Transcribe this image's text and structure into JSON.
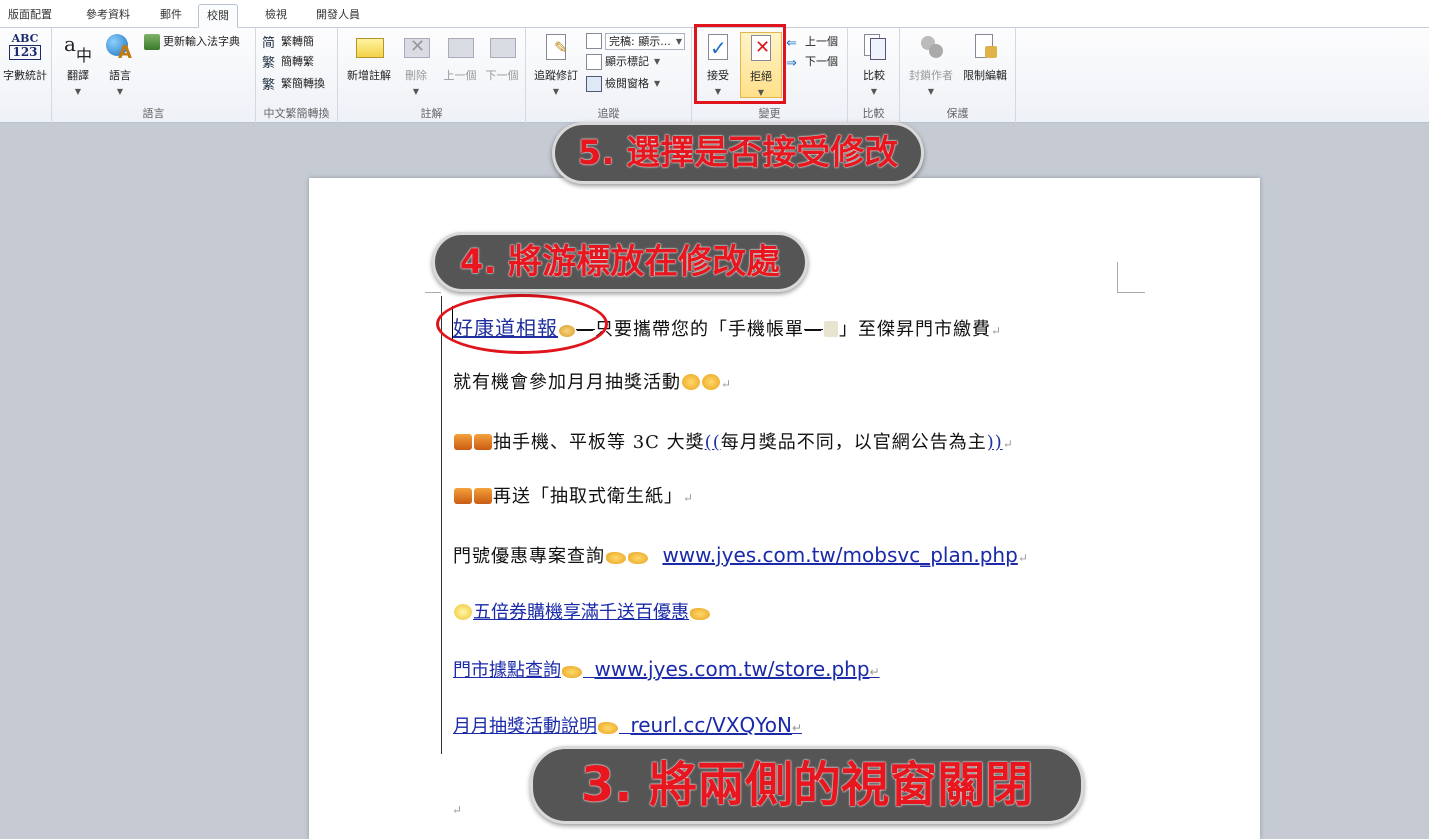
{
  "tabs": [
    "版面配置",
    "參考資料",
    "郵件",
    "校閱",
    "檢視",
    "開發人員"
  ],
  "active_tab": "校閱",
  "ribbon": {
    "proofing": {
      "word_count_icon_top": "ABC",
      "word_count_icon_bottom": "123",
      "word_count": "字數統計"
    },
    "language": {
      "translate": "翻譯",
      "language": "語言",
      "update_ime": "更新輸入法字典",
      "label": "語言"
    },
    "chinese": {
      "trad_to_simp": "繁轉簡",
      "simp_to_trad": "簡轉繁",
      "convert": "繁簡轉換",
      "label": "中文繁簡轉換"
    },
    "comments": {
      "new": "新增註解",
      "delete": "刪除",
      "prev": "上一個",
      "next": "下一個",
      "label": "註解"
    },
    "tracking": {
      "track_changes": "追蹤修訂",
      "display_combo": "完稿: 顯示...",
      "show_markup": "顯示標記",
      "review_pane": "檢閱窗格",
      "label": "追蹤"
    },
    "changes": {
      "accept": "接受",
      "reject": "拒絕",
      "prev": "上一個",
      "next": "下一個",
      "label": "變更"
    },
    "compare": {
      "compare": "比較",
      "label": "比較"
    },
    "protect": {
      "block_authors": "封鎖作者",
      "restrict_editing": "限制編輯",
      "label": "保護"
    }
  },
  "callouts": {
    "step5": "5. 選擇是否接受修改",
    "step4": "4. 將游標放在修改處",
    "step3": "3. 將兩側的視窗關閉"
  },
  "document": {
    "line1": {
      "inserted": "好康道相報",
      "text1": "只要攜帶您的「手機帳單",
      "text2": "」至傑昇門市繳費"
    },
    "line2": "就有機會參加月月抽獎活動",
    "line3": {
      "text": "抽手機、平板等 3C 大獎",
      "paren_open": "((",
      "inner": "每月獎品不同，以官網公告為主",
      "paren_close": "))"
    },
    "line4": "再送「抽取式衛生紙」",
    "line5": {
      "text": "門號優惠專案查詢",
      "link": "www.jyes.com.tw/mobsvc_plan.php"
    },
    "line6": "五倍券購機享滿千送百優惠",
    "line7": {
      "text": "門市據點查詢",
      "link": "www.jyes.com.tw/store.php"
    },
    "line8": {
      "text": "月月抽獎活動說明",
      "link": "reurl.cc/VXQYoN"
    },
    "pilcrow": "↵"
  }
}
